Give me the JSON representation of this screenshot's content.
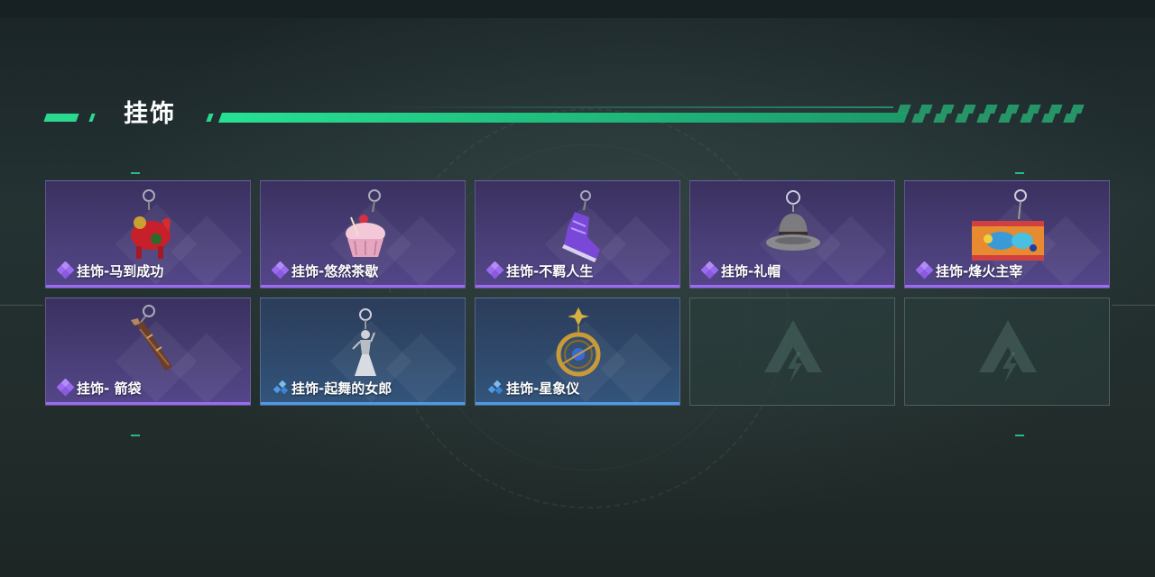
{
  "section": {
    "title": "挂饰"
  },
  "colors": {
    "accent_green": "#2ad88f",
    "rarity_purple": "#9c6cf0",
    "rarity_blue": "#4d9be6"
  },
  "items": [
    {
      "label": "挂饰-马到成功",
      "rarity": "purple",
      "icon": "red-horse-charm-icon"
    },
    {
      "label": "挂饰-悠然茶歇",
      "rarity": "purple",
      "icon": "cupcake-charm-icon"
    },
    {
      "label": "挂饰-不羁人生",
      "rarity": "purple",
      "icon": "purple-sneaker-charm-icon"
    },
    {
      "label": "挂饰-礼帽",
      "rarity": "purple",
      "icon": "fedora-hat-charm-icon"
    },
    {
      "label": "挂饰-烽火主宰",
      "rarity": "purple",
      "icon": "graffiti-tag-charm-icon"
    },
    {
      "label": "挂饰- 箭袋",
      "rarity": "purple",
      "icon": "quiver-charm-icon"
    },
    {
      "label": "挂饰-起舞的女郎",
      "rarity": "blue",
      "icon": "dancer-figurine-charm-icon"
    },
    {
      "label": "挂饰-星象仪",
      "rarity": "blue",
      "icon": "astrolabe-charm-icon"
    },
    {
      "label": "",
      "rarity": "empty",
      "icon": "empty-slot-logo-icon"
    },
    {
      "label": "",
      "rarity": "empty",
      "icon": "empty-slot-logo-icon"
    }
  ]
}
